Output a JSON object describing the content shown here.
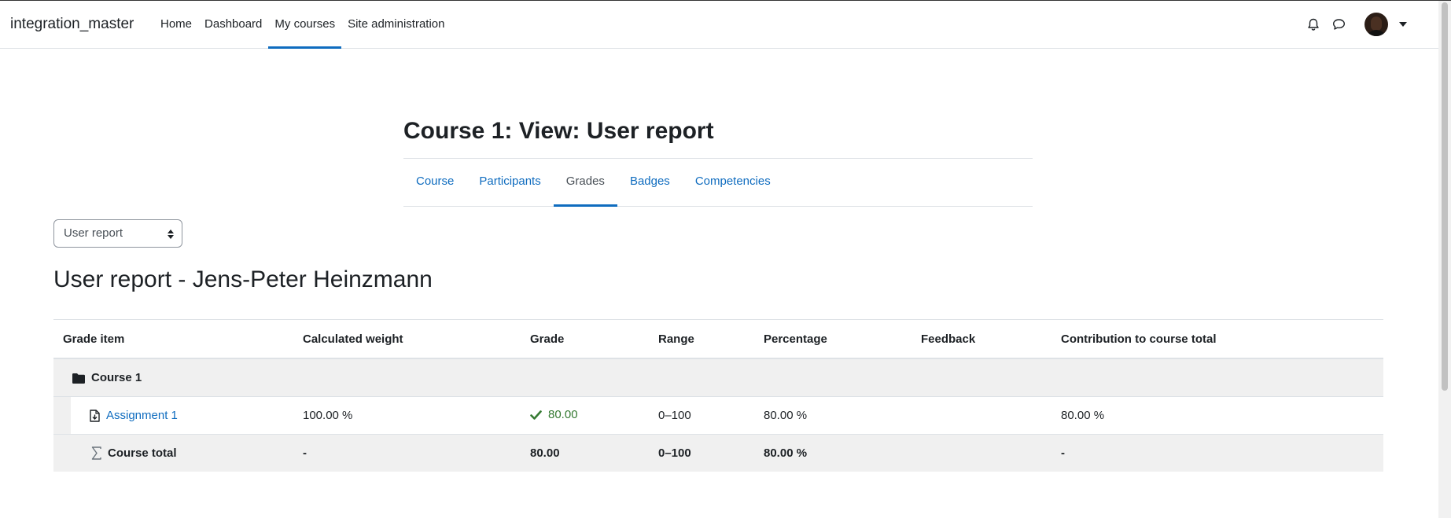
{
  "navbar": {
    "brand": "integration_master",
    "items": [
      {
        "label": "Home",
        "active": false
      },
      {
        "label": "Dashboard",
        "active": false
      },
      {
        "label": "My courses",
        "active": true
      },
      {
        "label": "Site administration",
        "active": false
      }
    ],
    "icons": [
      "bell-icon",
      "chat-icon",
      "avatar",
      "caret-down-icon"
    ]
  },
  "page": {
    "title": "Course 1: View: User report"
  },
  "secondary_nav": {
    "tabs": [
      {
        "label": "Course",
        "active": false
      },
      {
        "label": "Participants",
        "active": false
      },
      {
        "label": "Grades",
        "active": true
      },
      {
        "label": "Badges",
        "active": false
      },
      {
        "label": "Competencies",
        "active": false
      }
    ]
  },
  "report_select": {
    "selected": "User report"
  },
  "report": {
    "heading": "User report - Jens-Peter Heinzmann",
    "columns": [
      "Grade item",
      "Calculated weight",
      "Grade",
      "Range",
      "Percentage",
      "Feedback",
      "Contribution to course total"
    ],
    "category": {
      "name": "Course 1",
      "icon": "folder-icon"
    },
    "item": {
      "name": "Assignment 1",
      "icon": "assignment-icon",
      "weight": "100.00 %",
      "grade": "80.00",
      "grade_icon": "check-icon",
      "range": "0–100",
      "percentage": "80.00 %",
      "feedback": "",
      "contribution": "80.00 %"
    },
    "total": {
      "name": "Course total",
      "icon": "sigma-icon",
      "weight": "-",
      "grade": "80.00",
      "range": "0–100",
      "percentage": "80.00 %",
      "feedback": "",
      "contribution": "-"
    }
  },
  "colors": {
    "accent": "#0f6cbf",
    "success": "#357a32",
    "row_shade": "#f0f0f0"
  }
}
